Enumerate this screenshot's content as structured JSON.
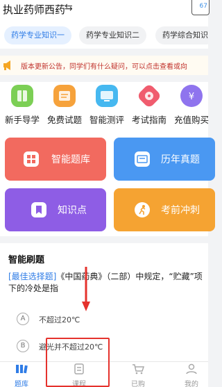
{
  "header": {
    "title": "执业药师西药",
    "swap_icon": "⇆",
    "calendar_text": "67"
  },
  "tabs": [
    "药学专业知识一",
    "药学专业知识二",
    "药学综合知识"
  ],
  "notice": {
    "text": "版本更新公告，同学们有什么疑问，可以点击查看或向"
  },
  "quick_links": [
    {
      "label": "新手导学",
      "icon": "book-icon",
      "color": "#7ccf55"
    },
    {
      "label": "免费试题",
      "icon": "exam-paper-icon",
      "color": "#f6a23b"
    },
    {
      "label": "智能测评",
      "icon": "monitor-icon",
      "color": "#46b8f0"
    },
    {
      "label": "考试指南",
      "icon": "compass-icon",
      "color": "#f05c6e"
    },
    {
      "label": "充值购买",
      "icon": "money-bag-icon",
      "color": "#8f74ee"
    }
  ],
  "tiles": [
    {
      "label": "智能题库",
      "icon": "grid-icon",
      "color": "#f26a5f"
    },
    {
      "label": "历年真题",
      "icon": "card-icon",
      "color": "#4a98f2"
    },
    {
      "label": "知识点",
      "icon": "bookmark-icon",
      "color": "#8e5de5"
    },
    {
      "label": "考前冲刺",
      "icon": "runner-icon",
      "color": "#f5a332"
    }
  ],
  "practice": {
    "title": "智能刷题",
    "question_type": "[最佳选择题]",
    "question_text": "《中国药典》（二部）中规定，“贮藏”项下的冷处是指",
    "options": [
      {
        "letter": "A",
        "text": "不超过20℃"
      },
      {
        "letter": "B",
        "text": "避光并不超过20℃"
      }
    ]
  },
  "bottom_nav": [
    {
      "label": "题库",
      "icon": "question-bank-icon",
      "active": true
    },
    {
      "label": "课程",
      "icon": "course-icon",
      "active": false
    },
    {
      "label": "已购",
      "icon": "cart-icon",
      "active": false
    },
    {
      "label": "我的",
      "icon": "profile-icon",
      "active": false
    }
  ],
  "colors": {
    "accent": "#2f7ce6",
    "notice_red": "#c0312b",
    "annotation_red": "#e5322d"
  }
}
